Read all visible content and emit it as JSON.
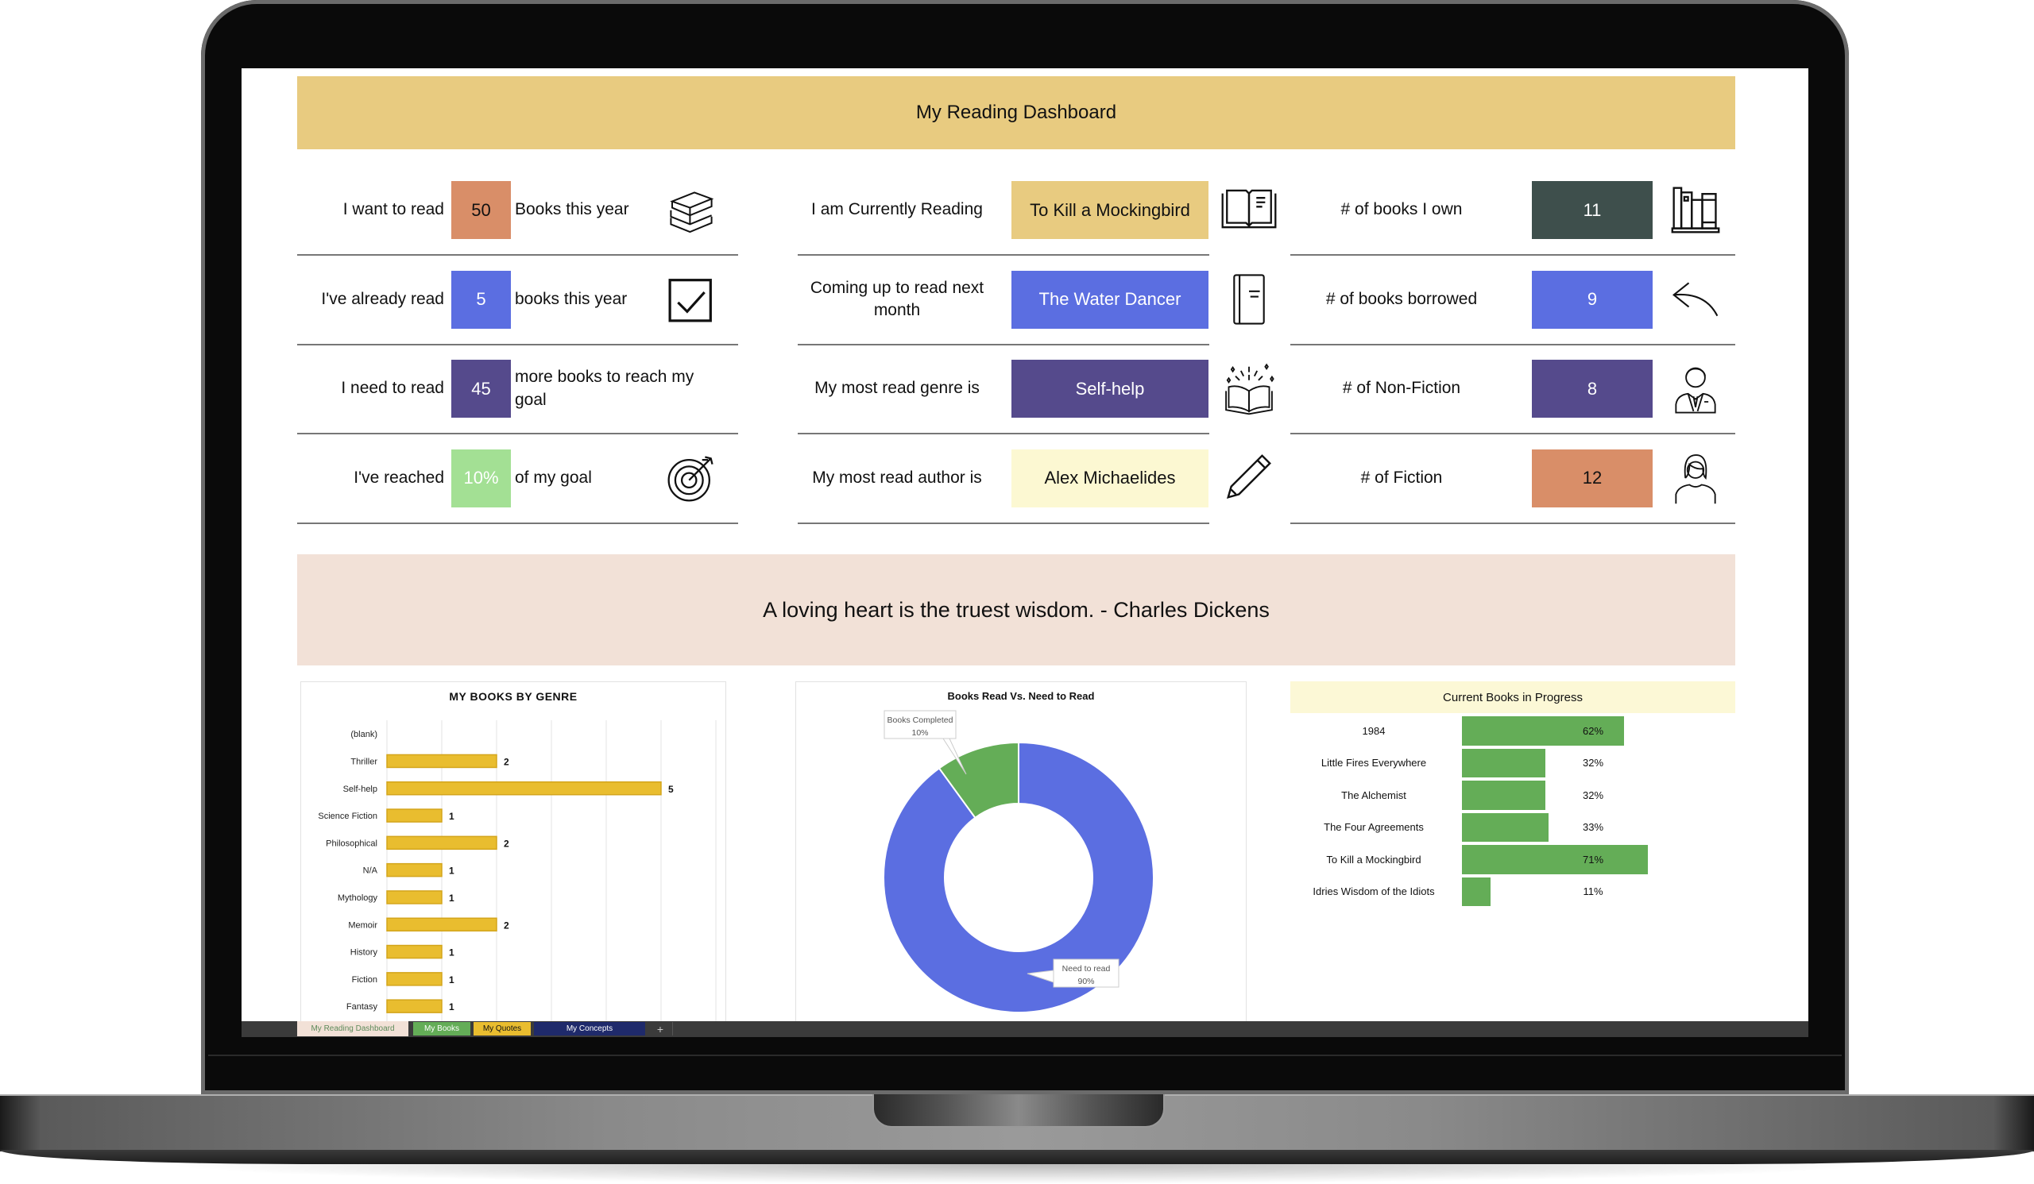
{
  "dashboard": {
    "title": "My Reading Dashboard",
    "quote": "A loving heart is the truest wisdom. - Charles Dickens"
  },
  "goals": [
    {
      "label": "I want to read",
      "value": "50",
      "suffix": "Books this year",
      "icon": "books-stack-icon",
      "color": "#d98e68",
      "text_color": "#111111"
    },
    {
      "label": "I've already read",
      "value": "5",
      "suffix": "books this year",
      "icon": "checkbox-checked-icon",
      "color": "#5b6ee1",
      "text_color": "#ffffff"
    },
    {
      "label": "I need to read",
      "value": "45",
      "suffix": "more books to reach my goal",
      "icon": "",
      "color": "#554a8c",
      "text_color": "#ffffff"
    },
    {
      "label": "I've reached",
      "value": "10%",
      "suffix": "of my goal",
      "icon": "target-icon",
      "color": "#a3e094",
      "text_color": "#ffffff"
    }
  ],
  "reading": [
    {
      "label": "I am Currently Reading",
      "value": "To Kill a Mockingbird",
      "icon": "open-book-icon",
      "color": "#e8cb80",
      "text_color": "#111111"
    },
    {
      "label": "Coming up to read next month",
      "value": "The Water Dancer",
      "icon": "closed-book-icon",
      "color": "#5b6ee1",
      "text_color": "#ffffff"
    },
    {
      "label": "My most read genre is",
      "value": "Self-help",
      "icon": "magic-book-icon",
      "color": "#554a8c",
      "text_color": "#ffffff"
    },
    {
      "label": "My most read author is",
      "value": "Alex Michaelides",
      "icon": "pencil-icon",
      "color": "#fcf8d2",
      "text_color": "#111111"
    }
  ],
  "counts": [
    {
      "label": "# of books I own",
      "value": "11",
      "icon": "bookshelf-icon",
      "color": "#3e4f4c",
      "text_color": "#ffffff"
    },
    {
      "label": "# of books borrowed",
      "value": "9",
      "icon": "return-arrow-icon",
      "color": "#5b6ee1",
      "text_color": "#ffffff"
    },
    {
      "label": "# of Non-Fiction",
      "value": "8",
      "icon": "businessman-icon",
      "color": "#554a8c",
      "text_color": "#ffffff"
    },
    {
      "label": "# of Fiction",
      "value": "12",
      "icon": "woman-icon",
      "color": "#d98e68",
      "text_color": "#111111"
    }
  ],
  "chart_data": [
    {
      "type": "bar",
      "orientation": "horizontal",
      "title": "MY BOOKS BY GENRE",
      "categories": [
        "(blank)",
        "Thriller",
        "Self-help",
        "Science Fiction",
        "Philosophical",
        "N/A",
        "Mythology",
        "Memoir",
        "History",
        "Fiction",
        "Fantasy"
      ],
      "values": [
        null,
        2,
        5,
        1,
        2,
        1,
        1,
        2,
        1,
        1,
        1
      ],
      "xlim": [
        0,
        6
      ],
      "xticks": [
        "0",
        "1",
        "2",
        "3",
        "4",
        "5",
        "6"
      ],
      "grid": true,
      "color": "#e9bd2f"
    },
    {
      "type": "pie",
      "variant": "donut",
      "title": "Books Read Vs. Need to Read",
      "slices": [
        {
          "label": "Books Completed",
          "value": 10,
          "display": "10%",
          "color": "#64ad57"
        },
        {
          "label": "Need to read",
          "value": 90,
          "display": "90%",
          "color": "#5b6ee1"
        }
      ]
    },
    {
      "type": "bar",
      "orientation": "horizontal",
      "title": "Current Books in Progress",
      "categories": [
        "1984",
        "Little Fires Everywhere",
        "The Alchemist",
        "The Four Agreements",
        "To Kill a Mockingbird",
        "Idries Wisdom of the Idiots"
      ],
      "values": [
        62,
        32,
        32,
        33,
        71,
        11
      ],
      "labels": [
        "62%",
        "32%",
        "32%",
        "33%",
        "71%",
        "11%"
      ],
      "xlim": [
        0,
        100
      ],
      "color": "#64ad57"
    }
  ],
  "sheet_tabs": [
    {
      "label": "My Reading Dashboard",
      "bg": "#f2e1d7",
      "fg": "#5d8a5a",
      "active": true
    },
    {
      "label": "My Books",
      "bg": "#64ad57",
      "fg": "#ffffff"
    },
    {
      "label": "My Quotes",
      "bg": "#e9bd2f",
      "fg": "#111111"
    },
    {
      "label": "My Concepts",
      "bg": "#1f2a6b",
      "fg": "#ffffff"
    }
  ],
  "add_sheet_label": "+"
}
